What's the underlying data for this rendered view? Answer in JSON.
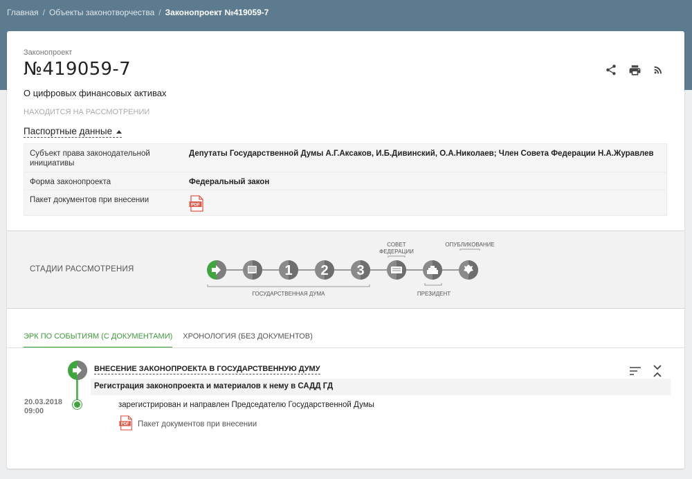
{
  "breadcrumb": {
    "items": [
      "Главная",
      "Объекты законотворчества"
    ],
    "current": "Законопроект №419059-7"
  },
  "bill": {
    "kind": "Законопроект",
    "number": "№419059-7",
    "title": "О цифровых финансовых активах",
    "status": "НАХОДИТСЯ НА РАССМОТРЕНИИ",
    "passport_toggle": "Паспортные данные"
  },
  "actions": [
    "share-icon",
    "print-icon",
    "rss-icon"
  ],
  "passport": [
    {
      "label": "Субъект права законодательной инициативы",
      "value": "Депутаты Государственной Думы А.Г.Аксаков, И.Б.Дивинский, О.А.Николаев; Член Совета Федерации Н.А.Журавлев"
    },
    {
      "label": "Форма законопроекта",
      "value": "Федеральный закон"
    },
    {
      "label": "Пакет документов при внесении",
      "value": ""
    }
  ],
  "stages": {
    "label": "СТАДИИ РАССМОТРЕНИЯ",
    "steps": [
      "arrow",
      "doc",
      "1",
      "2",
      "3",
      "council",
      "president",
      "emblem"
    ],
    "group_labels": {
      "duma": "ГОСУДАРСТВЕННАЯ ДУМА",
      "council_line1": "СОВЕТ",
      "council_line2": "ФЕДЕРАЦИИ",
      "president": "ПРЕЗИДЕНТ",
      "publication": "ОПУБЛИКОВАНИЕ"
    }
  },
  "tabs": [
    {
      "label": "ЭРК ПО СОБЫТИЯМ (С ДОКУМЕНТАМИ)",
      "active": true
    },
    {
      "label": "ХРОНОЛОГИЯ (БЕЗ ДОКУМЕНТОВ)",
      "active": false
    }
  ],
  "event": {
    "title": "ВНЕСЕНИЕ ЗАКОНОПРОЕКТА В ГОСУДАРСТВЕННУЮ ДУМУ",
    "subtitle": "Регистрация законопроекта и материалов к нему в САДД ГД",
    "date": "20.03.2018",
    "time": "09:00",
    "text": "зарегистрирован и направлен Председателю Государственной Думы",
    "doc_label": "Пакет документов при внесении"
  },
  "colors": {
    "header": "#5d7b8e",
    "accent": "#3c9b3a",
    "step_gray": "#7e7e7e",
    "pdf_red": "#e05a4a"
  }
}
